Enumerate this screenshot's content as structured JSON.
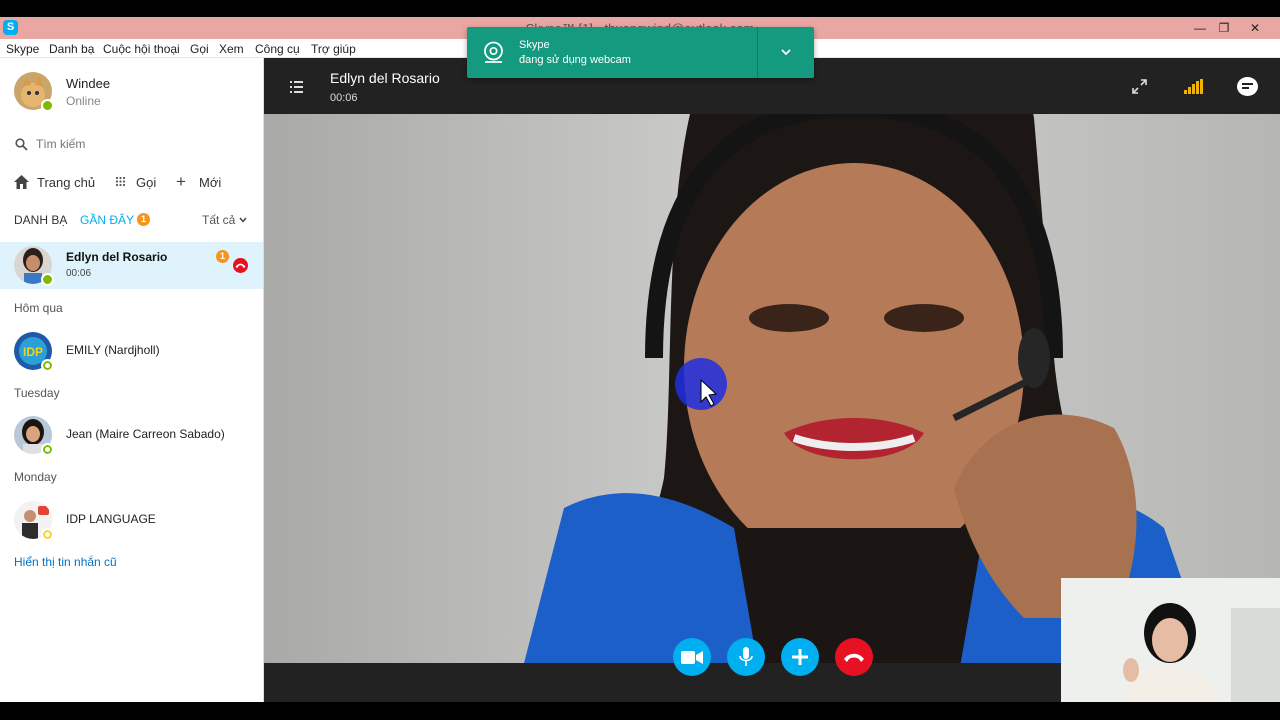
{
  "window": {
    "title": "Skype™ [1] - thuongwind@outlook.com",
    "app_icon": "S"
  },
  "menu": [
    "Skype",
    "Danh bạ",
    "Cuộc hội thoại",
    "Gọi",
    "Xem",
    "Công cụ",
    "Trợ giúp"
  ],
  "notification": {
    "title": "Skype",
    "text": "đang sử dụng webcam",
    "icon": "webcam-icon",
    "accent": "#139a7f"
  },
  "profile": {
    "name": "Windee",
    "status": "Online"
  },
  "search": {
    "placeholder": "Tìm kiếm"
  },
  "nav": {
    "home": "Trang chủ",
    "call": "Gọi",
    "new": "Mới"
  },
  "tabs": {
    "contacts": "DANH BẠ",
    "recent": "GẦN ĐÂY",
    "recent_badge": "1",
    "filter": "Tất cả"
  },
  "recent": {
    "active": {
      "name": "Edlyn del Rosario",
      "duration": "00:06",
      "badge": "1"
    },
    "groups": [
      {
        "label": "Hôm qua",
        "contact": "EMILY (Nardjholl)"
      },
      {
        "label": "Tuesday",
        "contact": "Jean (Maire Carreon Sabado)"
      },
      {
        "label": "Monday",
        "contact": "IDP LANGUAGE"
      }
    ],
    "older_link": "Hiển thị tin nhắn cũ"
  },
  "call": {
    "name": "Edlyn del Rosario",
    "timer": "00:06"
  },
  "colors": {
    "skype_blue": "#00aff0",
    "end_call_red": "#e81123",
    "selected_row": "#dff3fc",
    "link": "#0072c6"
  }
}
